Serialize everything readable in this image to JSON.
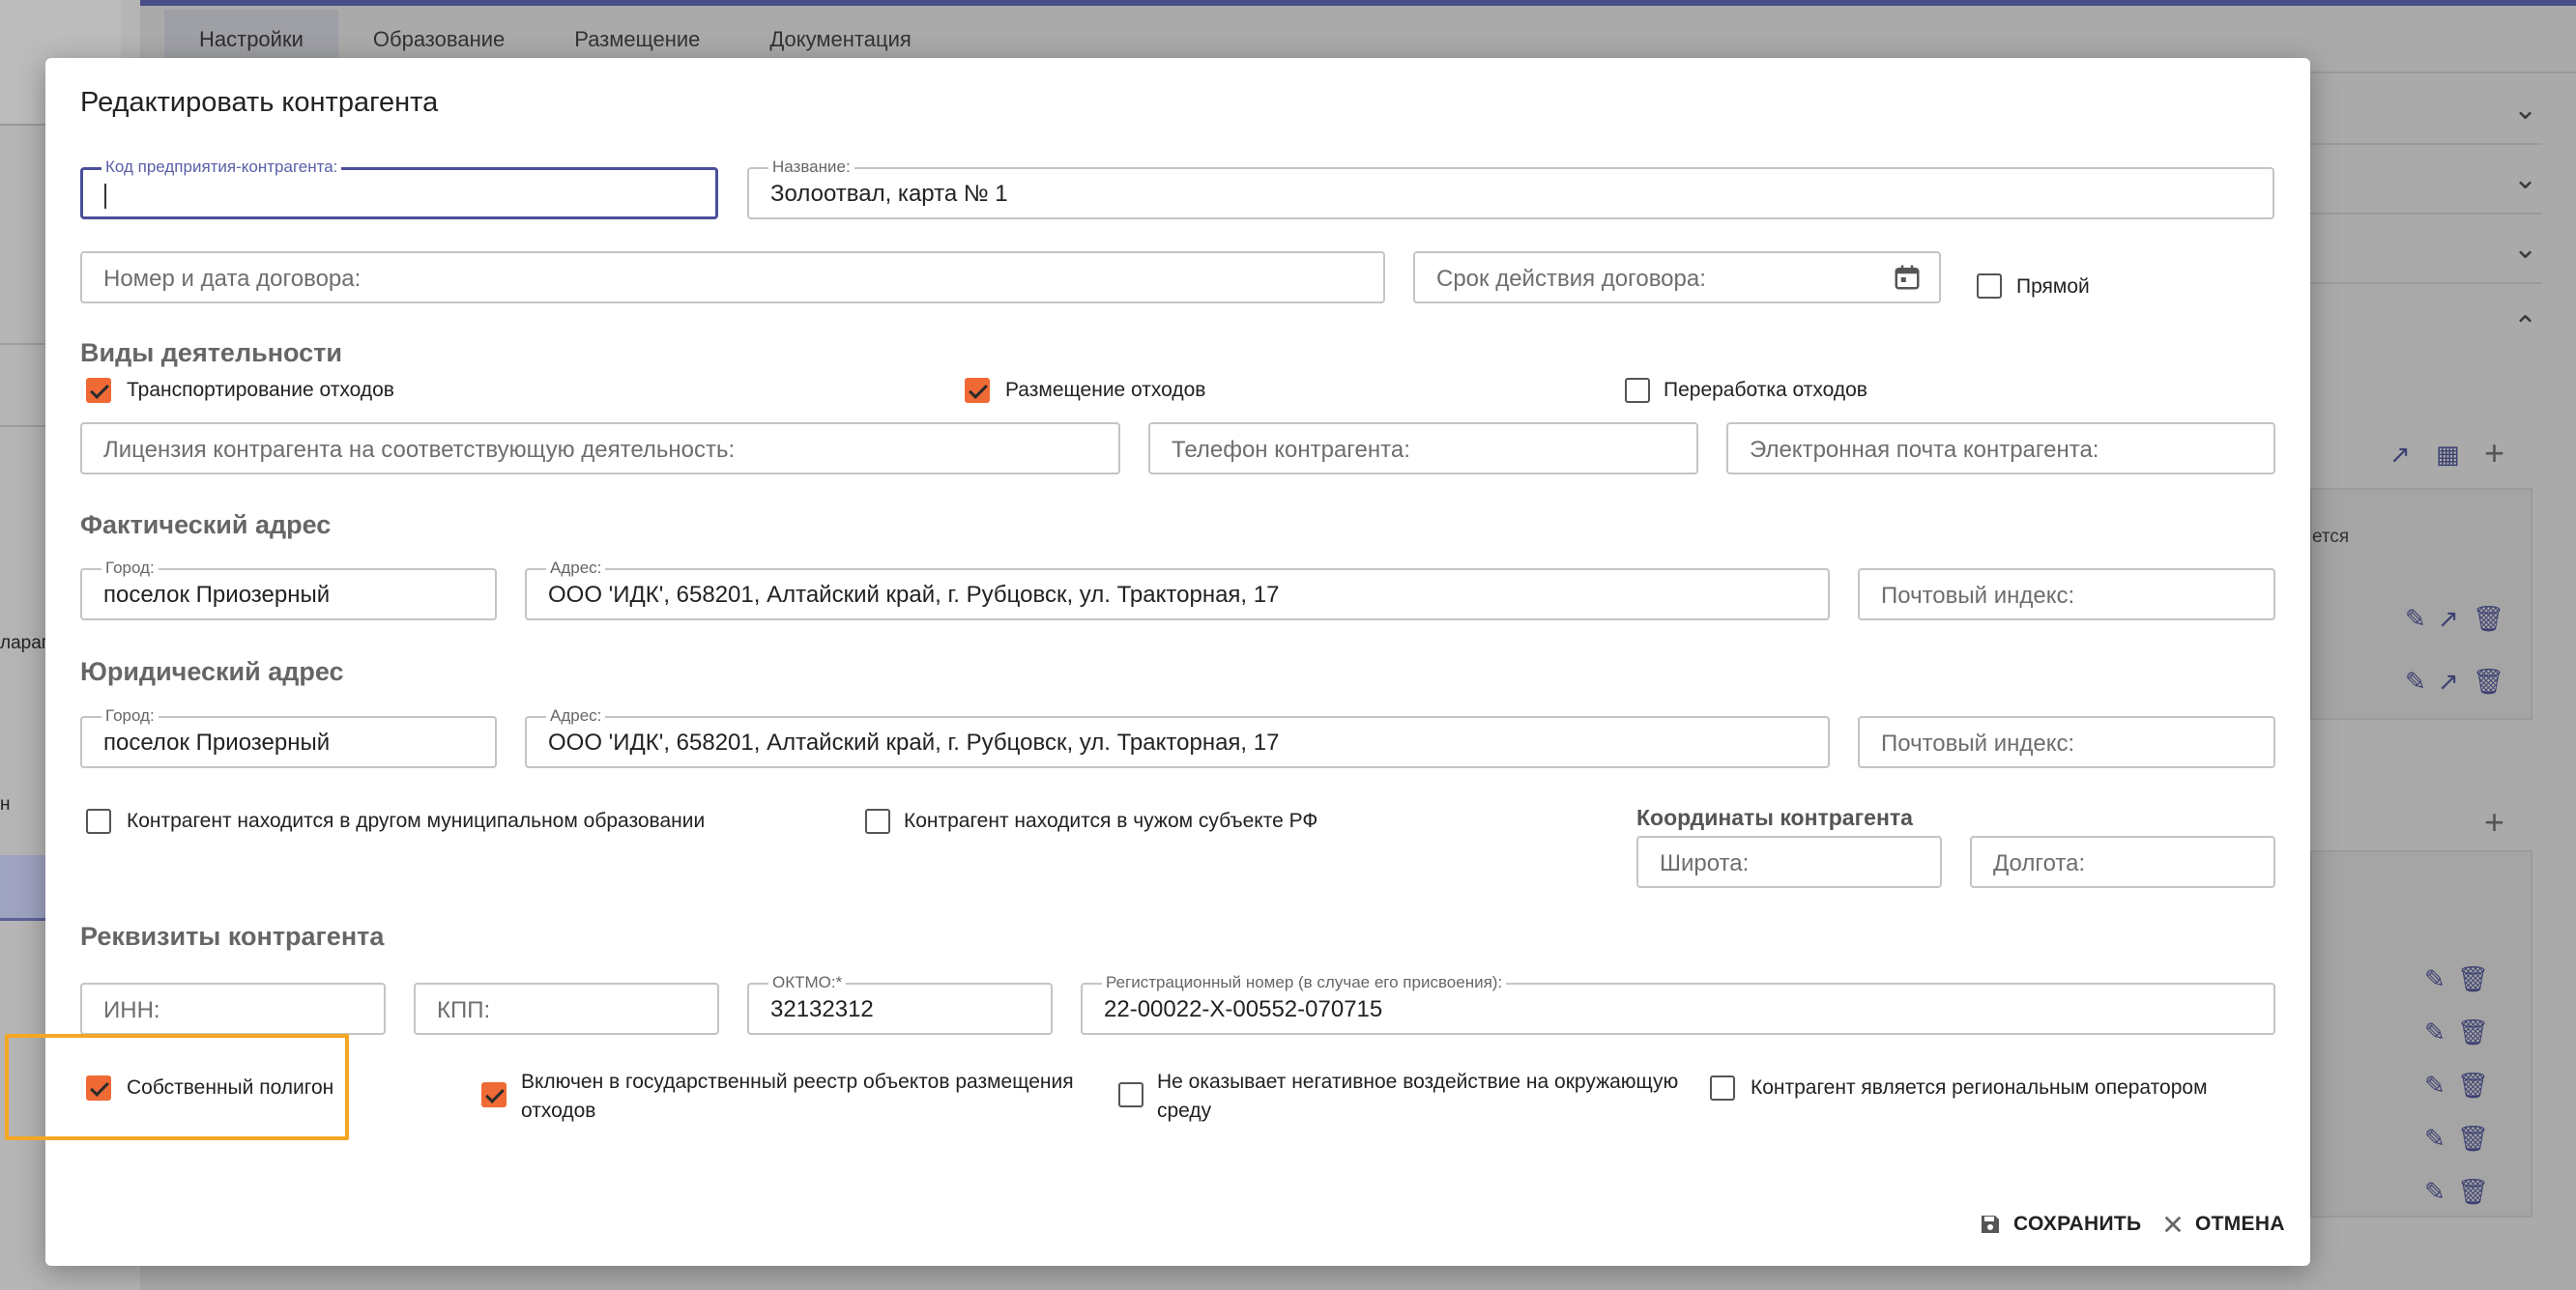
{
  "background": {
    "tabs": [
      "Настройки",
      "Образование",
      "Размещение",
      "Документация"
    ],
    "left_texts": [
      "ларап",
      "н"
    ],
    "right_text": "ется"
  },
  "modal": {
    "title": "Редактировать контрагента",
    "fields": {
      "code": {
        "label": "Код предприятия-контрагента:",
        "value": ""
      },
      "name": {
        "label": "Название:",
        "value": "Золоотвал, карта № 1"
      },
      "contract": {
        "placeholder": "Номер и дата договора:"
      },
      "contract_term": {
        "placeholder": "Срок действия договора:"
      },
      "license": {
        "placeholder": "Лицензия контрагента на соответствующую деятельность:"
      },
      "phone": {
        "placeholder": "Телефон контрагента:"
      },
      "email": {
        "placeholder": "Электронная почта контрагента:"
      },
      "fact_city": {
        "label": "Город:",
        "value": "поселок Приозерный"
      },
      "fact_address": {
        "label": "Адрес:",
        "value": "ООО 'ИДК', 658201, Алтайский край, г. Рубцовск, ул. Тракторная, 17"
      },
      "fact_zip": {
        "placeholder": "Почтовый индекс:"
      },
      "legal_city": {
        "label": "Город:",
        "value": "поселок Приозерный"
      },
      "legal_address": {
        "label": "Адрес:",
        "value": "ООО 'ИДК', 658201, Алтайский край, г. Рубцовск, ул. Тракторная, 17"
      },
      "legal_zip": {
        "placeholder": "Почтовый индекс:"
      },
      "latitude": {
        "placeholder": "Широта:"
      },
      "longitude": {
        "placeholder": "Долгота:"
      },
      "inn": {
        "placeholder": "ИНН:"
      },
      "kpp": {
        "placeholder": "КПП:"
      },
      "oktmo": {
        "label": "ОКТМО:*",
        "value": "32132312"
      },
      "reg_number": {
        "label": "Регистрационный номер (в случае его присвоения):",
        "value": "22-00022-Х-00552-070715"
      }
    },
    "direct_label": "Прямой",
    "direct_checked": false,
    "sections": {
      "activities": "Виды деятельности",
      "fact_address": "Фактический адрес",
      "legal_address": "Юридический адрес",
      "requisites": "Реквизиты контрагента",
      "coordinates": "Координаты контрагента"
    },
    "activities": [
      {
        "label": "Транспортирование отходов",
        "checked": true
      },
      {
        "label": "Размещение отходов",
        "checked": true
      },
      {
        "label": "Переработка отходов",
        "checked": false
      }
    ],
    "location_flags": [
      {
        "label": "Контрагент находится в другом муниципальном образовании",
        "checked": false
      },
      {
        "label": "Контрагент находится в чужом субъекте РФ",
        "checked": false
      }
    ],
    "bottom_flags": [
      {
        "label": "Собственный полигон",
        "checked": true
      },
      {
        "label": "Включен в государственный реестр объектов размещения отходов",
        "checked": true
      },
      {
        "label": "Не оказывает негативное воздействие на окружающую среду",
        "checked": false
      },
      {
        "label": "Контрагент является региональным оператором",
        "checked": false
      }
    ],
    "buttons": {
      "save": "СОХРАНИТЬ",
      "cancel": "ОТМЕНА"
    },
    "colors": {
      "accent": "#f06a35",
      "focus": "#4a4f9a",
      "highlight": "#f5a623"
    }
  }
}
